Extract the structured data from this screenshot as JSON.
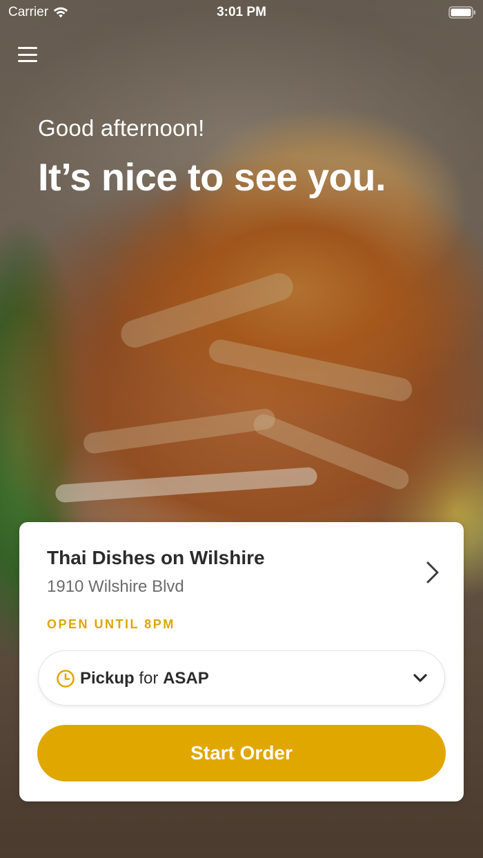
{
  "status_bar": {
    "carrier": "Carrier",
    "time": "3:01 PM",
    "icons": [
      "wifi-icon",
      "battery-icon"
    ]
  },
  "header": {
    "menu_icon": "hamburger-menu-icon"
  },
  "greeting": {
    "subtitle": "Good afternoon!",
    "title": "It’s nice to see you."
  },
  "store_card": {
    "name": "Thai Dishes on Wilshire",
    "address": "1910 Wilshire Blvd",
    "hours": "OPEN UNTIL 8PM",
    "chevron_icon": "chevron-right-icon",
    "order_mode": {
      "icon": "clock-icon",
      "method": "Pickup",
      "connector": "for",
      "time": "ASAP",
      "dropdown_icon": "chevron-down-icon"
    },
    "cta_label": "Start Order"
  },
  "colors": {
    "accent": "#e0a700",
    "hours_text": "#dda600",
    "card_background": "#ffffff",
    "title_text": "#2b2b2b",
    "secondary_text": "#6b6b6b"
  }
}
